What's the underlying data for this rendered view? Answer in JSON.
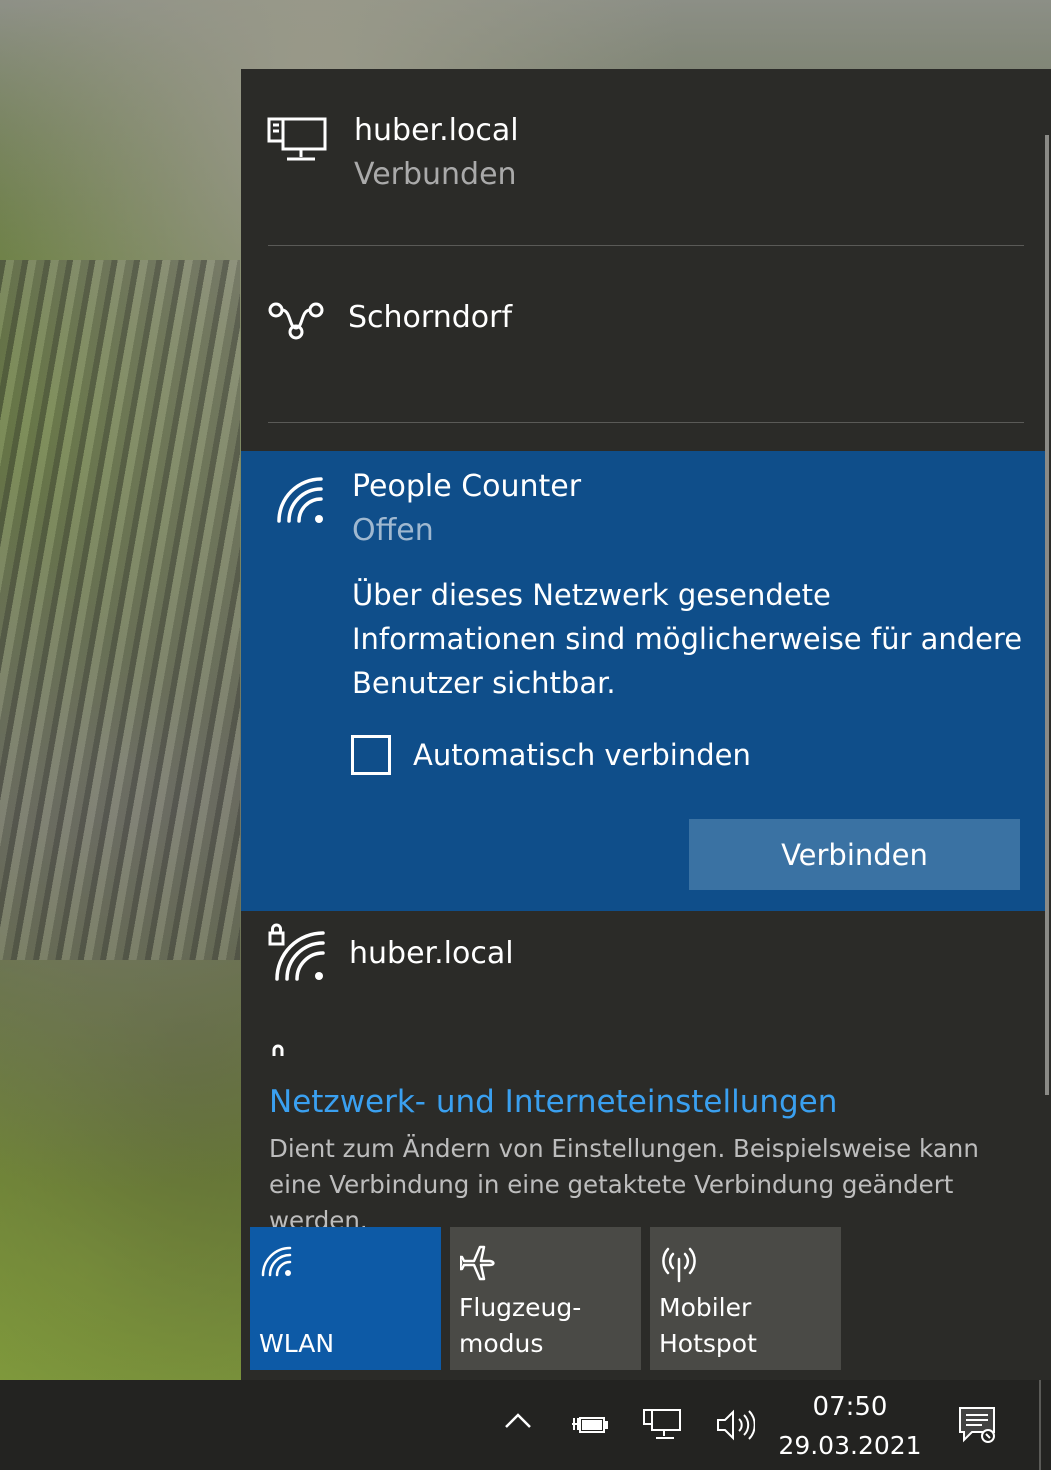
{
  "networks": [
    {
      "name": "huber.local",
      "status": "Verbunden",
      "icon": "ethernet-icon"
    },
    {
      "name": "Schorndorf",
      "status": "",
      "icon": "dialup-icon"
    },
    {
      "name": "People Counter",
      "status": "Offen",
      "icon": "wifi-icon",
      "warning": "Über dieses Netzwerk gesendete Informationen sind möglicherweise für andere Benutzer sichtbar.",
      "auto_connect_label": "Automatisch verbinden",
      "connect_label": "Verbinden"
    },
    {
      "name": "huber.local",
      "status": "",
      "icon": "wifi-secured-icon"
    }
  ],
  "settings": {
    "link": "Netzwerk- und Interneteinstellungen",
    "description": "Dient zum Ändern von Einstellungen. Beispielsweise kann eine Verbindung in eine getaktete Verbindung geändert werden."
  },
  "quick_actions": [
    {
      "label": "WLAN",
      "icon": "wifi-icon",
      "active": true
    },
    {
      "label": "Flugzeug-\nmodus",
      "icon": "airplane-icon",
      "active": false
    },
    {
      "label": "Mobiler\nHotspot",
      "icon": "hotspot-icon",
      "active": false
    }
  ],
  "taskbar": {
    "time": "07:50",
    "date": "29.03.2021",
    "tray_icons": [
      "chevron-up-icon",
      "battery-charging-icon",
      "network-icon",
      "volume-icon",
      "notification-icon"
    ]
  },
  "colors": {
    "flyout_bg": "#2b2b28",
    "selected_bg": "#0f4e8a",
    "accent_tile": "#0d5aa6",
    "link": "#3aa0f0"
  }
}
